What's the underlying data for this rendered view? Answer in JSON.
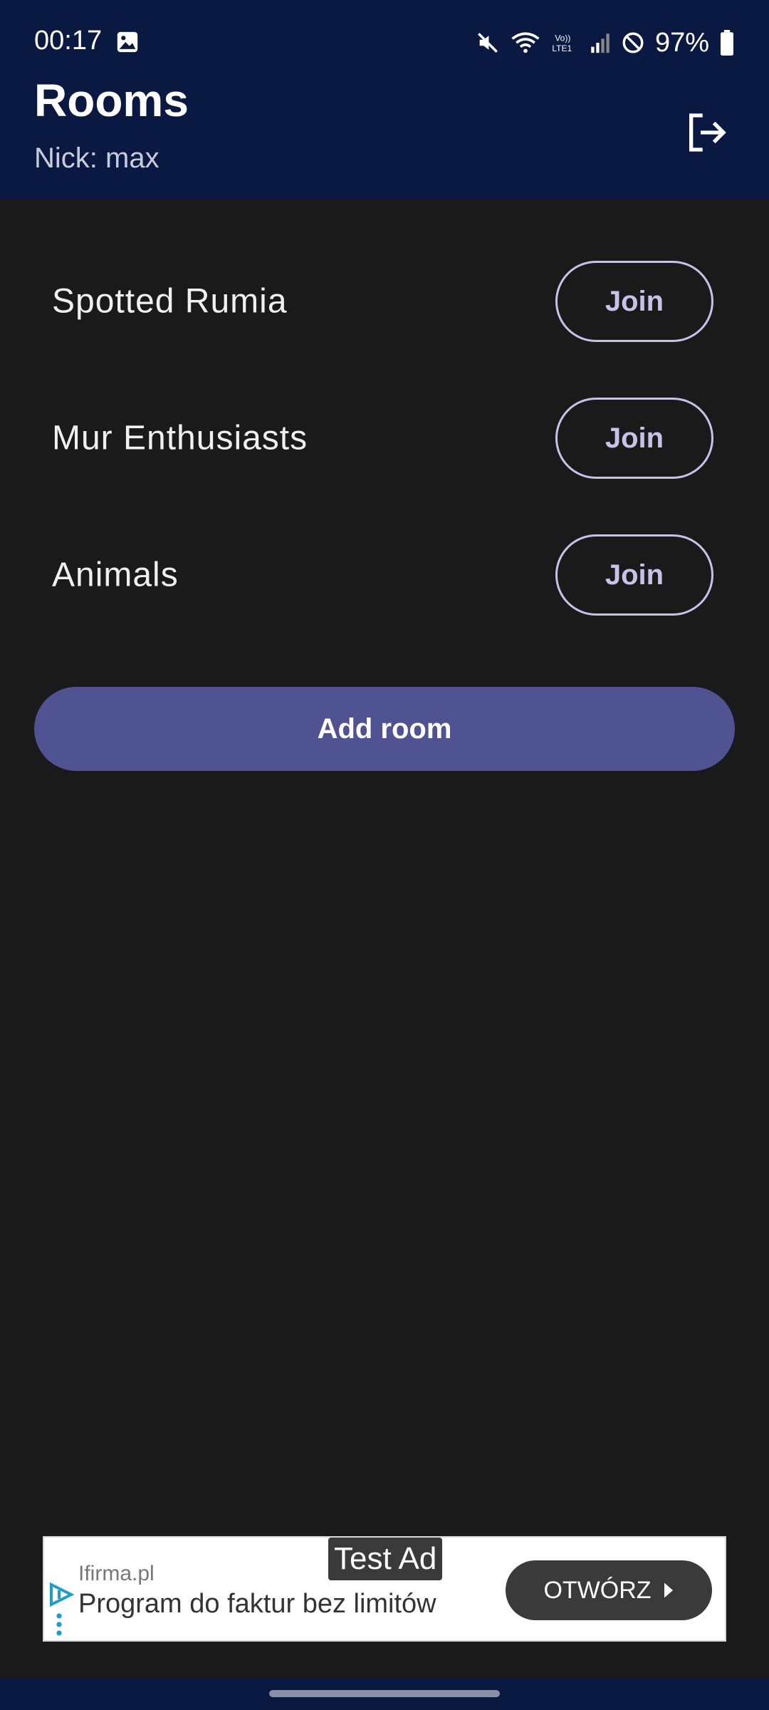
{
  "status_bar": {
    "time": "00:17",
    "battery": "97%"
  },
  "header": {
    "title": "Rooms",
    "nick": "Nick: max",
    "logout_icon": "logout-icon"
  },
  "rooms": [
    {
      "name": "Spotted Rumia",
      "join_label": "Join"
    },
    {
      "name": "Mur Enthusiasts",
      "join_label": "Join"
    },
    {
      "name": "Animals",
      "join_label": "Join"
    }
  ],
  "add_room_label": "Add room",
  "ad": {
    "label": "Test Ad",
    "domain": "Ifirma.pl",
    "headline": "Program do faktur bez limitów",
    "cta": "OTWÓRZ"
  },
  "colors": {
    "header_bg": "#0a1942",
    "body_bg": "#1a1a1a",
    "accent": "#4f5391",
    "join_outline": "#c8c2e8"
  }
}
